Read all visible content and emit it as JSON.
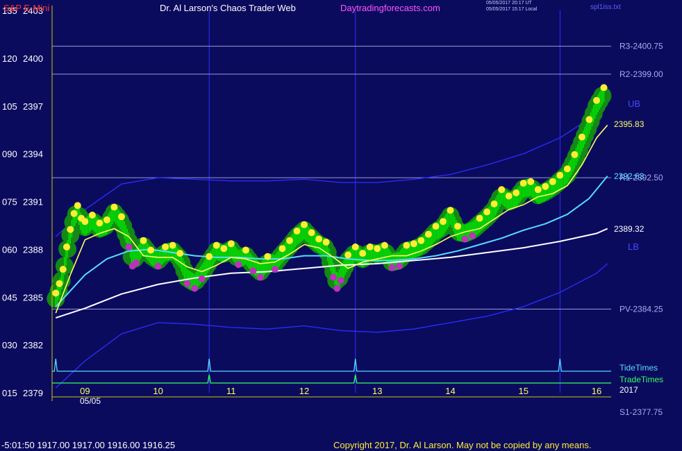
{
  "header": {
    "symbol": "S&P E-Mini",
    "site_title": "Dr. Al Larson's Chaos Trader Web",
    "site_link": "Daytradingforecasts.com",
    "stamp_utc": "05/05/2017 20:17 UT",
    "stamp_local": "05/05/2017 15:17 Local",
    "file_name": "spl1iss.txt"
  },
  "footer": {
    "quote": "-5:01:50  1917.00 1917.00 1916.00 1916.25",
    "copyright": "Copyright 2017, Dr. Al Larson. May not be copied by any means."
  },
  "colors": {
    "background": "#0b0b5e",
    "price": "#00ee00",
    "bubble": "#138a13",
    "high_dot": "#ffee33",
    "low_dot": "#bb33bb",
    "fast_ma": "#ffff66",
    "mid_ma": "#55ddff",
    "slow_ma": "#ffffff",
    "band": "#2d2dff",
    "tide": "#55ddff",
    "trade": "#33ff66",
    "symbol": "#ff3333",
    "link": "#ff55ff"
  },
  "chart_data": {
    "type": "line",
    "x_ticks": [
      "09",
      "10",
      "11",
      "12",
      "13",
      "14",
      "15",
      "16"
    ],
    "date_label": "05/05",
    "year_label": "2017",
    "left_ticks": [
      "135",
      "120",
      "105",
      "090",
      "075",
      "060",
      "045",
      "030",
      "015"
    ],
    "y_ticks": [
      "2403",
      "2400",
      "2397",
      "2394",
      "2391",
      "2388",
      "2385",
      "2382",
      "2379"
    ],
    "ylim": [
      2379,
      2403
    ],
    "xlim": [
      8.55,
      16.2
    ],
    "levels": [
      {
        "name": "R3-2400.75",
        "value": 2400.75
      },
      {
        "name": "R2-2399.00",
        "value": 2399.0
      },
      {
        "name": "R1-2392.50",
        "value": 2392.5
      },
      {
        "name": "PV-2384.25",
        "value": 2384.25
      },
      {
        "name": "S1-2377.75",
        "value": 2377.75
      }
    ],
    "end_labels": {
      "upper_band": "UB",
      "lower_band": "LB",
      "price_last": "2395.83",
      "mid_ma_last": "2392.63",
      "slow_ma_last": "2389.32"
    },
    "series": [
      {
        "name": "",
        "role": "price",
        "x": [
          8.6,
          8.65,
          8.7,
          8.75,
          8.8,
          8.85,
          8.9,
          8.95,
          9.0,
          9.1,
          9.2,
          9.3,
          9.4,
          9.5,
          9.6,
          9.65,
          9.7,
          9.8,
          9.9,
          10.0,
          10.1,
          10.2,
          10.3,
          10.4,
          10.5,
          10.6,
          10.7,
          10.8,
          10.9,
          11.0,
          11.1,
          11.2,
          11.3,
          11.4,
          11.5,
          11.6,
          11.7,
          11.8,
          11.9,
          12.0,
          12.1,
          12.2,
          12.3,
          12.4,
          12.45,
          12.5,
          12.6,
          12.7,
          12.8,
          12.9,
          13.0,
          13.1,
          13.2,
          13.3,
          13.4,
          13.5,
          13.6,
          13.7,
          13.8,
          13.9,
          14.0,
          14.1,
          14.2,
          14.3,
          14.4,
          14.5,
          14.6,
          14.7,
          14.8,
          14.9,
          15.0,
          15.1,
          15.2,
          15.3,
          15.4,
          15.5,
          15.6,
          15.7,
          15.8,
          15.9,
          16.0,
          16.1
        ],
        "values": [
          2384.9,
          2385.5,
          2386.4,
          2387.8,
          2388.9,
          2389.9,
          2390.4,
          2389.6,
          2389.4,
          2389.8,
          2389.3,
          2389.5,
          2390.3,
          2389.7,
          2388.5,
          2387.3,
          2387.5,
          2388.2,
          2387.6,
          2387.3,
          2387.8,
          2387.9,
          2387.4,
          2386.2,
          2385.9,
          2386.5,
          2387.2,
          2387.9,
          2387.7,
          2388.0,
          2387.4,
          2387.6,
          2387.0,
          2386.6,
          2387.2,
          2387.1,
          2387.7,
          2388.2,
          2388.8,
          2389.2,
          2388.7,
          2388.3,
          2388.1,
          2386.6,
          2385.9,
          2386.4,
          2387.3,
          2387.8,
          2387.4,
          2387.8,
          2387.7,
          2387.9,
          2387.2,
          2387.3,
          2387.9,
          2388.0,
          2388.2,
          2388.6,
          2389.1,
          2389.4,
          2390.1,
          2389.1,
          2389.0,
          2389.2,
          2389.6,
          2390.0,
          2390.5,
          2391.4,
          2391.0,
          2391.2,
          2391.8,
          2391.9,
          2391.4,
          2391.6,
          2391.9,
          2392.3,
          2392.7,
          2393.6,
          2394.7,
          2395.8,
          2397.0,
          2397.8
        ]
      },
      {
        "name": "",
        "role": "fast_ma",
        "x": [
          8.6,
          8.8,
          9.0,
          9.2,
          9.4,
          9.6,
          9.8,
          10.0,
          10.2,
          10.4,
          10.6,
          10.8,
          11.0,
          11.2,
          11.4,
          11.6,
          11.8,
          12.0,
          12.2,
          12.4,
          12.6,
          12.8,
          13.0,
          13.2,
          13.4,
          13.6,
          13.8,
          14.0,
          14.2,
          14.4,
          14.6,
          14.8,
          15.0,
          15.2,
          15.4,
          15.6,
          15.8,
          16.0,
          16.15
        ],
        "values": [
          2384.0,
          2386.4,
          2388.6,
          2389.0,
          2389.3,
          2388.8,
          2387.6,
          2387.5,
          2387.5,
          2386.9,
          2386.6,
          2387.0,
          2387.5,
          2387.4,
          2387.1,
          2387.2,
          2387.7,
          2388.3,
          2388.1,
          2387.5,
          2386.8,
          2387.2,
          2387.4,
          2387.6,
          2387.6,
          2387.9,
          2388.3,
          2388.8,
          2389.1,
          2389.3,
          2389.9,
          2390.5,
          2390.8,
          2391.3,
          2391.5,
          2392.0,
          2393.3,
          2395.0,
          2395.8
        ]
      },
      {
        "name": "",
        "role": "mid_ma",
        "x": [
          8.6,
          8.8,
          9.0,
          9.3,
          9.6,
          9.9,
          10.2,
          10.5,
          10.8,
          11.1,
          11.4,
          11.7,
          12.0,
          12.3,
          12.6,
          12.9,
          13.2,
          13.5,
          13.8,
          14.1,
          14.4,
          14.7,
          15.0,
          15.3,
          15.6,
          15.9,
          16.15
        ],
        "values": [
          2384.4,
          2385.4,
          2386.4,
          2387.4,
          2387.9,
          2388.0,
          2387.8,
          2387.6,
          2387.5,
          2387.5,
          2387.4,
          2387.4,
          2387.6,
          2387.6,
          2387.4,
          2387.3,
          2387.3,
          2387.4,
          2387.6,
          2387.9,
          2388.3,
          2388.7,
          2389.2,
          2389.6,
          2390.2,
          2391.2,
          2392.6
        ]
      },
      {
        "name": "",
        "role": "slow_ma",
        "x": [
          8.6,
          9.0,
          9.5,
          10.0,
          10.5,
          11.0,
          11.5,
          12.0,
          12.5,
          13.0,
          13.5,
          14.0,
          14.5,
          15.0,
          15.5,
          16.0,
          16.15
        ],
        "values": [
          2383.7,
          2384.3,
          2385.2,
          2385.8,
          2386.2,
          2386.5,
          2386.6,
          2386.8,
          2387.0,
          2387.1,
          2387.3,
          2387.5,
          2387.8,
          2388.1,
          2388.5,
          2389.0,
          2389.3
        ]
      },
      {
        "name": "",
        "role": "upper_band",
        "x": [
          8.6,
          9.0,
          9.5,
          10.0,
          10.5,
          11.0,
          11.5,
          12.0,
          12.5,
          13.0,
          13.5,
          14.0,
          14.5,
          15.0,
          15.5,
          16.0,
          16.15
        ],
        "values": [
          2388.8,
          2390.5,
          2392.1,
          2392.5,
          2392.4,
          2392.3,
          2392.3,
          2392.4,
          2392.2,
          2392.2,
          2392.4,
          2392.7,
          2393.3,
          2394.0,
          2395.0,
          2396.5,
          2397.2
        ]
      },
      {
        "name": "",
        "role": "lower_band",
        "x": [
          8.6,
          9.0,
          9.5,
          10.0,
          10.5,
          11.0,
          11.5,
          12.0,
          12.5,
          13.0,
          13.5,
          14.0,
          14.5,
          15.0,
          15.5,
          16.0,
          16.15
        ],
        "values": [
          2379.3,
          2381.0,
          2382.7,
          2383.4,
          2383.3,
          2383.1,
          2383.0,
          2383.2,
          2382.9,
          2382.8,
          2383.0,
          2383.4,
          2383.8,
          2384.4,
          2385.3,
          2386.5,
          2387.1
        ]
      }
    ],
    "tide_times": [
      8.6,
      10.7,
      12.7,
      15.5
    ],
    "trade_times": [
      10.7,
      12.7
    ],
    "annotations": [
      "TideTimes",
      "TradeTimes"
    ]
  }
}
